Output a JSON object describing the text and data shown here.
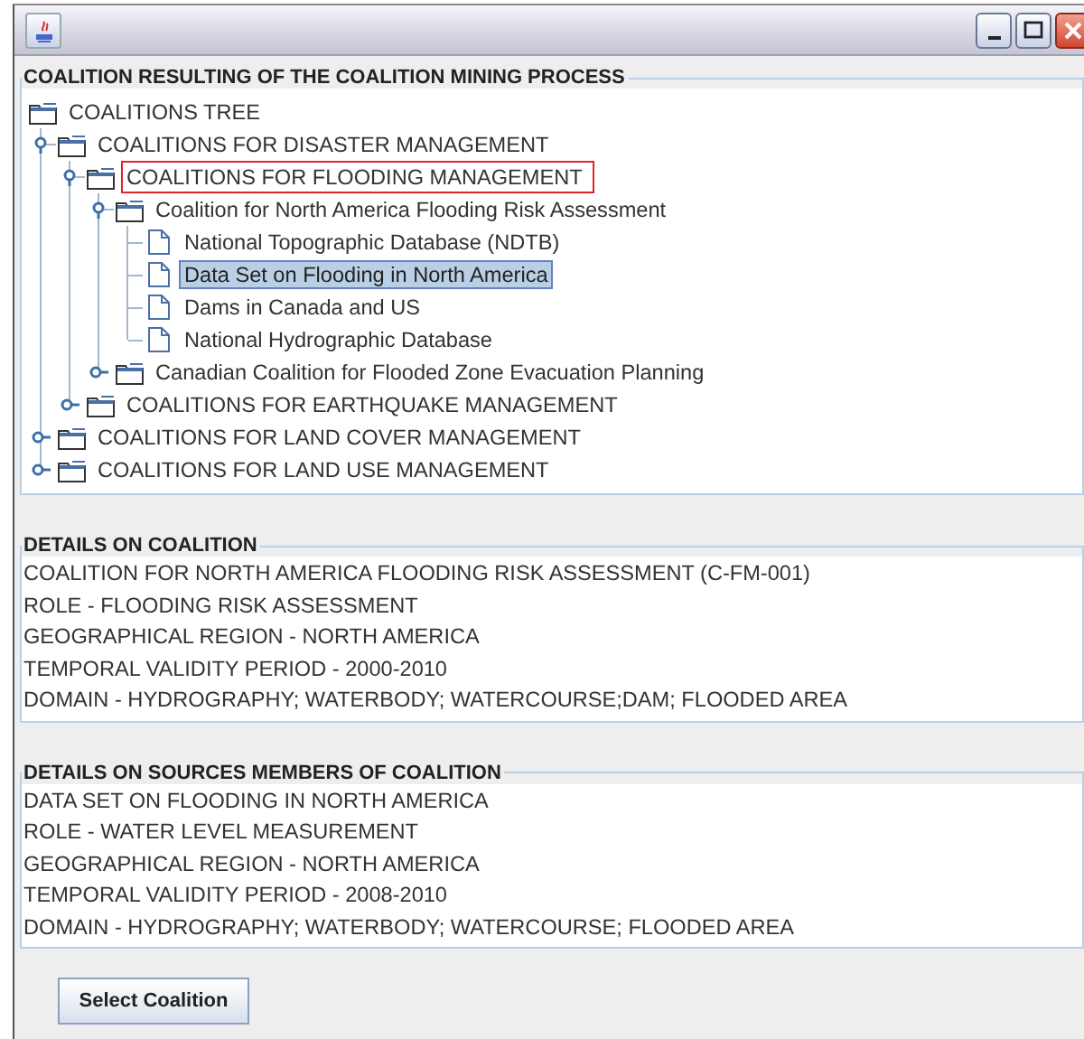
{
  "window": {
    "controls": [
      {
        "kind": "minimize"
      },
      {
        "kind": "maximize"
      },
      {
        "kind": "close"
      }
    ]
  },
  "tree_panel": {
    "title": "COALITION RESULTING OF THE COALITION MINING PROCESS",
    "root": {
      "label": "COALITIONS TREE",
      "kind": "folder",
      "selected": false,
      "outlined": false,
      "children": [
        {
          "label": "COALITIONS FOR DISASTER MANAGEMENT",
          "kind": "folder",
          "expanded": true,
          "selected": false,
          "outlined": false,
          "children": [
            {
              "label": "COALITIONS FOR FLOODING MANAGEMENT",
              "kind": "folder",
              "expanded": true,
              "selected": false,
              "outlined": true,
              "children": [
                {
                  "label": "Coalition for North America Flooding Risk Assessment",
                  "kind": "folder",
                  "expanded": true,
                  "selected": false,
                  "outlined": false,
                  "children": [
                    {
                      "label": "National Topographic Database (NDTB)",
                      "kind": "file",
                      "selected": false,
                      "outlined": false
                    },
                    {
                      "label": "Data Set on Flooding in North America",
                      "kind": "file",
                      "selected": true,
                      "outlined": false
                    },
                    {
                      "label": "Dams in Canada and US",
                      "kind": "file",
                      "selected": false,
                      "outlined": false
                    },
                    {
                      "label": "National Hydrographic Database",
                      "kind": "file",
                      "selected": false,
                      "outlined": false
                    }
                  ]
                },
                {
                  "label": "Canadian Coalition for Flooded Zone Evacuation Planning",
                  "kind": "folder",
                  "expanded": false,
                  "selected": false,
                  "outlined": false
                }
              ]
            },
            {
              "label": "COALITIONS FOR EARTHQUAKE MANAGEMENT",
              "kind": "folder",
              "expanded": false,
              "selected": false,
              "outlined": false
            }
          ]
        },
        {
          "label": "COALITIONS FOR LAND COVER MANAGEMENT",
          "kind": "folder",
          "expanded": false,
          "selected": false,
          "outlined": false
        },
        {
          "label": "COALITIONS FOR LAND USE MANAGEMENT",
          "kind": "folder",
          "expanded": false,
          "selected": false,
          "outlined": false
        }
      ]
    }
  },
  "details_panels": [
    {
      "title": "DETAILS ON COALITION",
      "lines": [
        "COALITION FOR NORTH AMERICA FLOODING RISK ASSESSMENT (C-FM-001)",
        "ROLE - FLOODING RISK ASSESSMENT",
        "GEOGRAPHICAL REGION - NORTH AMERICA",
        "TEMPORAL VALIDITY PERIOD - 2000-2010",
        "DOMAIN - HYDROGRAPHY; WATERBODY; WATERCOURSE;DAM; FLOODED AREA"
      ]
    },
    {
      "title": "DETAILS ON SOURCES MEMBERS OF COALITION",
      "lines": [
        "DATA SET ON FLOODING IN NORTH AMERICA",
        "ROLE - WATER LEVEL MEASUREMENT",
        "GEOGRAPHICAL REGION - NORTH AMERICA",
        "TEMPORAL VALIDITY PERIOD - 2008-2010",
        "DOMAIN - HYDROGRAPHY; WATERBODY; WATERCOURSE; FLOODED AREA"
      ]
    }
  ],
  "button": "Select Coalition"
}
